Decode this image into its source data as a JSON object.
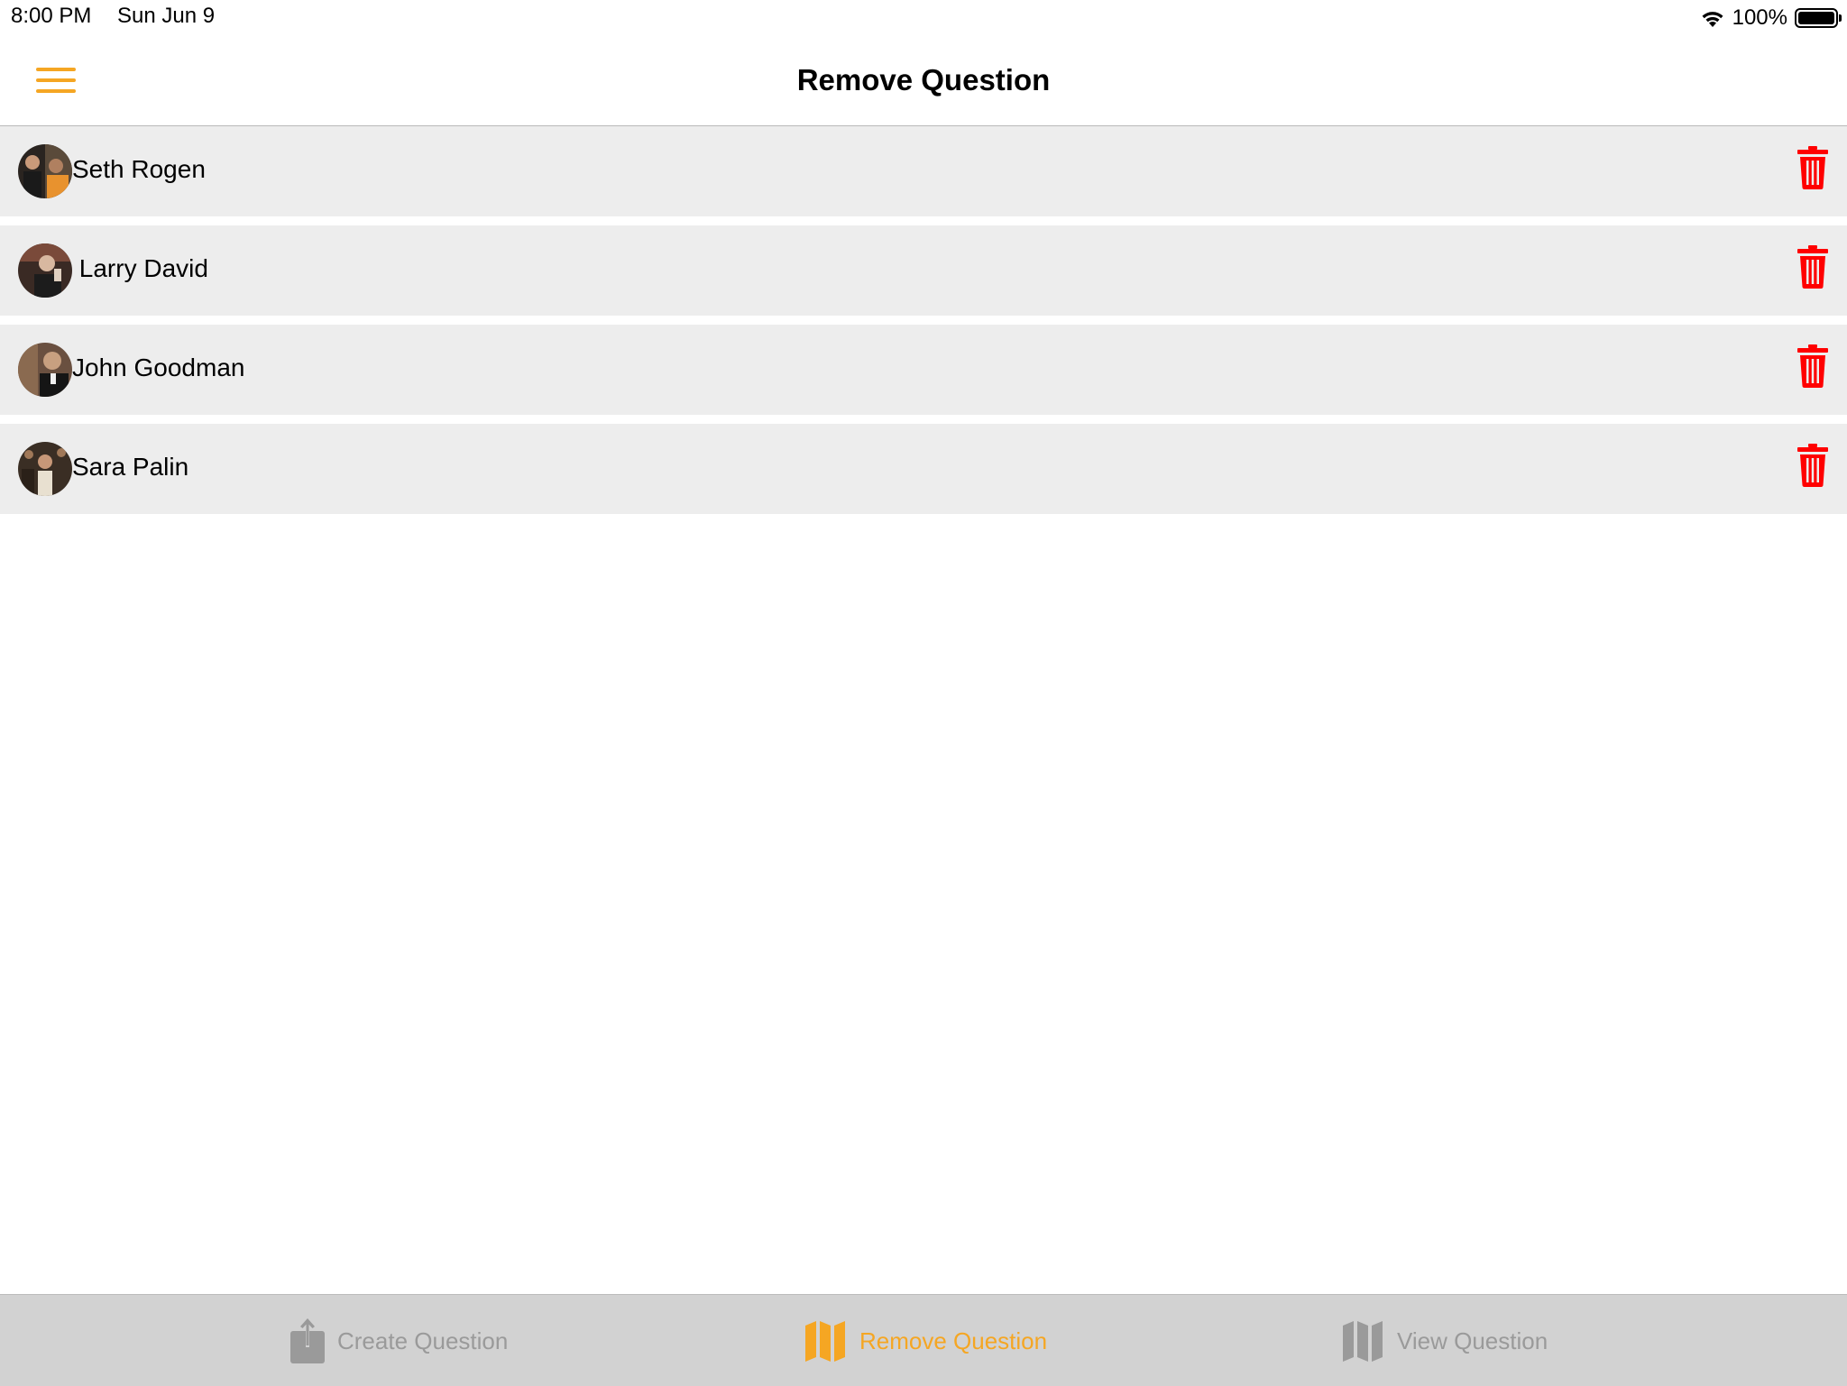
{
  "status_bar": {
    "time": "8:00 PM",
    "date": "Sun Jun 9",
    "battery": "100%",
    "battery_level": 1.0
  },
  "nav": {
    "title": "Remove Question",
    "menu_icon": "hamburger-menu-icon",
    "accent_color": "#f5a623"
  },
  "list": {
    "delete_icon": "trash-icon",
    "delete_color": "#ff0000",
    "items": [
      {
        "label": "Seth Rogen"
      },
      {
        "label": " Larry David"
      },
      {
        "label": "John Goodman"
      },
      {
        "label": "Sara Palin"
      }
    ]
  },
  "tabs": [
    {
      "label": "Create Question",
      "icon": "share-upload-icon",
      "selected": false
    },
    {
      "label": "Remove Question",
      "icon": "map-icon",
      "selected": true
    },
    {
      "label": "View Question",
      "icon": "map-icon",
      "selected": false
    }
  ]
}
